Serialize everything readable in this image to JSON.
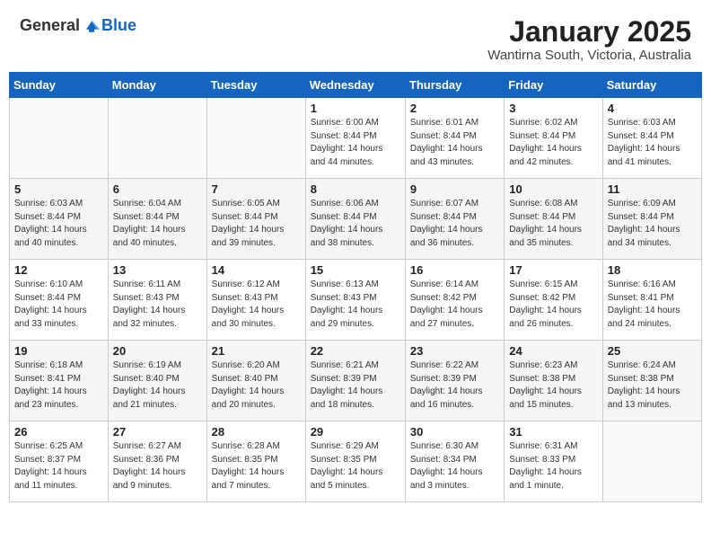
{
  "logo": {
    "general": "General",
    "blue": "Blue"
  },
  "title": {
    "month_year": "January 2025",
    "location": "Wantirna South, Victoria, Australia"
  },
  "headers": [
    "Sunday",
    "Monday",
    "Tuesday",
    "Wednesday",
    "Thursday",
    "Friday",
    "Saturday"
  ],
  "weeks": [
    [
      {
        "day": "",
        "info": ""
      },
      {
        "day": "",
        "info": ""
      },
      {
        "day": "",
        "info": ""
      },
      {
        "day": "1",
        "info": "Sunrise: 6:00 AM\nSunset: 8:44 PM\nDaylight: 14 hours\nand 44 minutes."
      },
      {
        "day": "2",
        "info": "Sunrise: 6:01 AM\nSunset: 8:44 PM\nDaylight: 14 hours\nand 43 minutes."
      },
      {
        "day": "3",
        "info": "Sunrise: 6:02 AM\nSunset: 8:44 PM\nDaylight: 14 hours\nand 42 minutes."
      },
      {
        "day": "4",
        "info": "Sunrise: 6:03 AM\nSunset: 8:44 PM\nDaylight: 14 hours\nand 41 minutes."
      }
    ],
    [
      {
        "day": "5",
        "info": "Sunrise: 6:03 AM\nSunset: 8:44 PM\nDaylight: 14 hours\nand 40 minutes."
      },
      {
        "day": "6",
        "info": "Sunrise: 6:04 AM\nSunset: 8:44 PM\nDaylight: 14 hours\nand 40 minutes."
      },
      {
        "day": "7",
        "info": "Sunrise: 6:05 AM\nSunset: 8:44 PM\nDaylight: 14 hours\nand 39 minutes."
      },
      {
        "day": "8",
        "info": "Sunrise: 6:06 AM\nSunset: 8:44 PM\nDaylight: 14 hours\nand 38 minutes."
      },
      {
        "day": "9",
        "info": "Sunrise: 6:07 AM\nSunset: 8:44 PM\nDaylight: 14 hours\nand 36 minutes."
      },
      {
        "day": "10",
        "info": "Sunrise: 6:08 AM\nSunset: 8:44 PM\nDaylight: 14 hours\nand 35 minutes."
      },
      {
        "day": "11",
        "info": "Sunrise: 6:09 AM\nSunset: 8:44 PM\nDaylight: 14 hours\nand 34 minutes."
      }
    ],
    [
      {
        "day": "12",
        "info": "Sunrise: 6:10 AM\nSunset: 8:44 PM\nDaylight: 14 hours\nand 33 minutes."
      },
      {
        "day": "13",
        "info": "Sunrise: 6:11 AM\nSunset: 8:43 PM\nDaylight: 14 hours\nand 32 minutes."
      },
      {
        "day": "14",
        "info": "Sunrise: 6:12 AM\nSunset: 8:43 PM\nDaylight: 14 hours\nand 30 minutes."
      },
      {
        "day": "15",
        "info": "Sunrise: 6:13 AM\nSunset: 8:43 PM\nDaylight: 14 hours\nand 29 minutes."
      },
      {
        "day": "16",
        "info": "Sunrise: 6:14 AM\nSunset: 8:42 PM\nDaylight: 14 hours\nand 27 minutes."
      },
      {
        "day": "17",
        "info": "Sunrise: 6:15 AM\nSunset: 8:42 PM\nDaylight: 14 hours\nand 26 minutes."
      },
      {
        "day": "18",
        "info": "Sunrise: 6:16 AM\nSunset: 8:41 PM\nDaylight: 14 hours\nand 24 minutes."
      }
    ],
    [
      {
        "day": "19",
        "info": "Sunrise: 6:18 AM\nSunset: 8:41 PM\nDaylight: 14 hours\nand 23 minutes."
      },
      {
        "day": "20",
        "info": "Sunrise: 6:19 AM\nSunset: 8:40 PM\nDaylight: 14 hours\nand 21 minutes."
      },
      {
        "day": "21",
        "info": "Sunrise: 6:20 AM\nSunset: 8:40 PM\nDaylight: 14 hours\nand 20 minutes."
      },
      {
        "day": "22",
        "info": "Sunrise: 6:21 AM\nSunset: 8:39 PM\nDaylight: 14 hours\nand 18 minutes."
      },
      {
        "day": "23",
        "info": "Sunrise: 6:22 AM\nSunset: 8:39 PM\nDaylight: 14 hours\nand 16 minutes."
      },
      {
        "day": "24",
        "info": "Sunrise: 6:23 AM\nSunset: 8:38 PM\nDaylight: 14 hours\nand 15 minutes."
      },
      {
        "day": "25",
        "info": "Sunrise: 6:24 AM\nSunset: 8:38 PM\nDaylight: 14 hours\nand 13 minutes."
      }
    ],
    [
      {
        "day": "26",
        "info": "Sunrise: 6:25 AM\nSunset: 8:37 PM\nDaylight: 14 hours\nand 11 minutes."
      },
      {
        "day": "27",
        "info": "Sunrise: 6:27 AM\nSunset: 8:36 PM\nDaylight: 14 hours\nand 9 minutes."
      },
      {
        "day": "28",
        "info": "Sunrise: 6:28 AM\nSunset: 8:35 PM\nDaylight: 14 hours\nand 7 minutes."
      },
      {
        "day": "29",
        "info": "Sunrise: 6:29 AM\nSunset: 8:35 PM\nDaylight: 14 hours\nand 5 minutes."
      },
      {
        "day": "30",
        "info": "Sunrise: 6:30 AM\nSunset: 8:34 PM\nDaylight: 14 hours\nand 3 minutes."
      },
      {
        "day": "31",
        "info": "Sunrise: 6:31 AM\nSunset: 8:33 PM\nDaylight: 14 hours\nand 1 minute."
      },
      {
        "day": "",
        "info": ""
      }
    ]
  ]
}
